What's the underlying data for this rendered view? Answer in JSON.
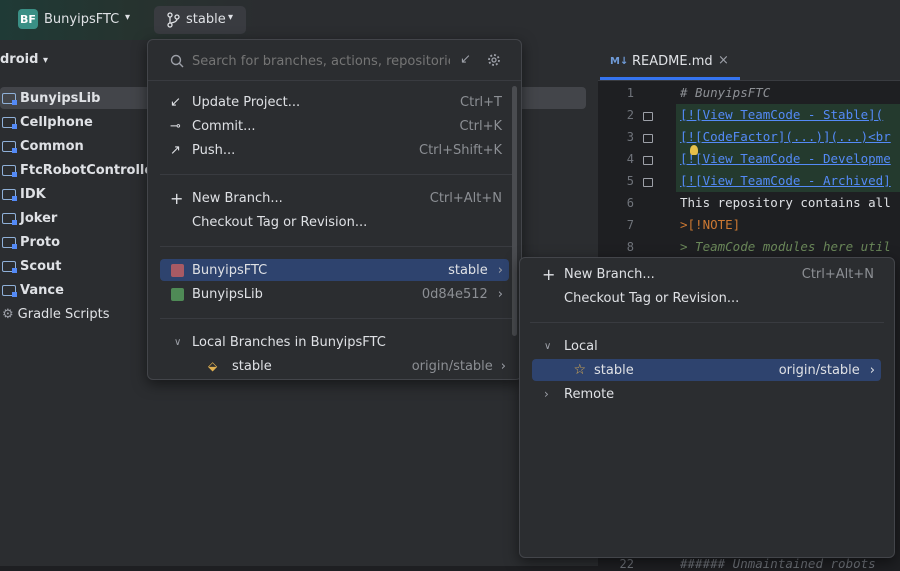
{
  "titlebar": {
    "project_badge": "BF",
    "project_name": "BunyipsFTC",
    "branch": "stable"
  },
  "project_panel": {
    "view_name": "droid",
    "items": [
      {
        "label": "BunyipsLib",
        "bold": true
      },
      {
        "label": "Cellphone",
        "bold": true
      },
      {
        "label": "Common",
        "bold": true
      },
      {
        "label": "FtcRobotController",
        "bold": true
      },
      {
        "label": "IDK",
        "bold": true
      },
      {
        "label": "Joker",
        "bold": true
      },
      {
        "label": "Proto",
        "bold": true
      },
      {
        "label": "Scout",
        "bold": true
      },
      {
        "label": "Vance",
        "bold": true
      },
      {
        "label": "Gradle Scripts",
        "bold": false
      }
    ]
  },
  "editor": {
    "tab_icon": "M↓",
    "tab_title": "README.md",
    "line_numbers": [
      "1",
      "2",
      "3",
      "4",
      "5",
      "6",
      "7",
      "8"
    ],
    "bottom_line_number": "22",
    "lines": [
      "# BunyipsFTC",
      "[![View TeamCode - Stable](",
      "[![CodeFactor](...)](...)<br",
      "[![View TeamCode - Developme",
      "[![View TeamCode - Archived]",
      "This repository contains all",
      ">[!NOTE]",
      "> TeamCode modules here util"
    ],
    "bottom_line": "###### Unmaintained robots"
  },
  "branch_popup": {
    "search_placeholder": "Search for branches, actions, repositories",
    "actions": [
      {
        "label": "Update Project...",
        "shortcut": "Ctrl+T"
      },
      {
        "label": "Commit...",
        "shortcut": "Ctrl+K"
      },
      {
        "label": "Push...",
        "shortcut": "Ctrl+Shift+K"
      }
    ],
    "new_branch": {
      "label": "New Branch...",
      "shortcut": "Ctrl+Alt+N"
    },
    "checkout_tag": "Checkout Tag or Revision...",
    "repos": [
      {
        "name": "BunyipsFTC",
        "branch": "stable",
        "color": "#a85a64"
      },
      {
        "name": "BunyipsLib",
        "branch": "0d84e512",
        "color": "#4f8a56"
      }
    ],
    "local_header": "Local Branches in BunyipsFTC",
    "local_branch": {
      "name": "stable",
      "tracking": "origin/stable"
    }
  },
  "repo_submenu": {
    "new_branch": {
      "label": "New Branch...",
      "shortcut": "Ctrl+Alt+N"
    },
    "checkout_tag": "Checkout Tag or Revision...",
    "local_label": "Local",
    "local_branch": {
      "name": "stable",
      "tracking": "origin/stable"
    },
    "remote_label": "Remote"
  },
  "colors": {
    "accent": "#3574f0",
    "selection": "#2e436e",
    "background": "#1e1f22"
  }
}
